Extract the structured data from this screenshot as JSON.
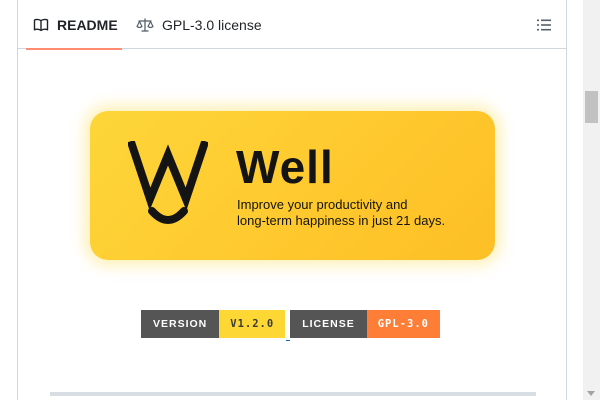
{
  "tabs": {
    "readme": {
      "label": "README",
      "icon": "book-icon",
      "active": true
    },
    "license": {
      "label": "GPL-3.0 license",
      "icon": "scale-icon"
    },
    "menu_icon": "list-icon"
  },
  "banner": {
    "logo_icon": "well-logo-icon",
    "name": "Well",
    "tagline_line1": "Improve your productivity and",
    "tagline_line2": "long-term happiness in just 21 days.",
    "colors": {
      "background": "#fdd63a",
      "text": "#141414"
    }
  },
  "badges": [
    {
      "label": "VERSION",
      "value": "V1.2.0",
      "value_color": "#fdd835"
    },
    {
      "label": "LICENSE",
      "value": "GPL-3.0",
      "value_color": "#fe7d37"
    }
  ],
  "colors": {
    "tab_underline": "#fd8c73",
    "badge_label_bg": "#555555",
    "border": "#d0d7de"
  }
}
